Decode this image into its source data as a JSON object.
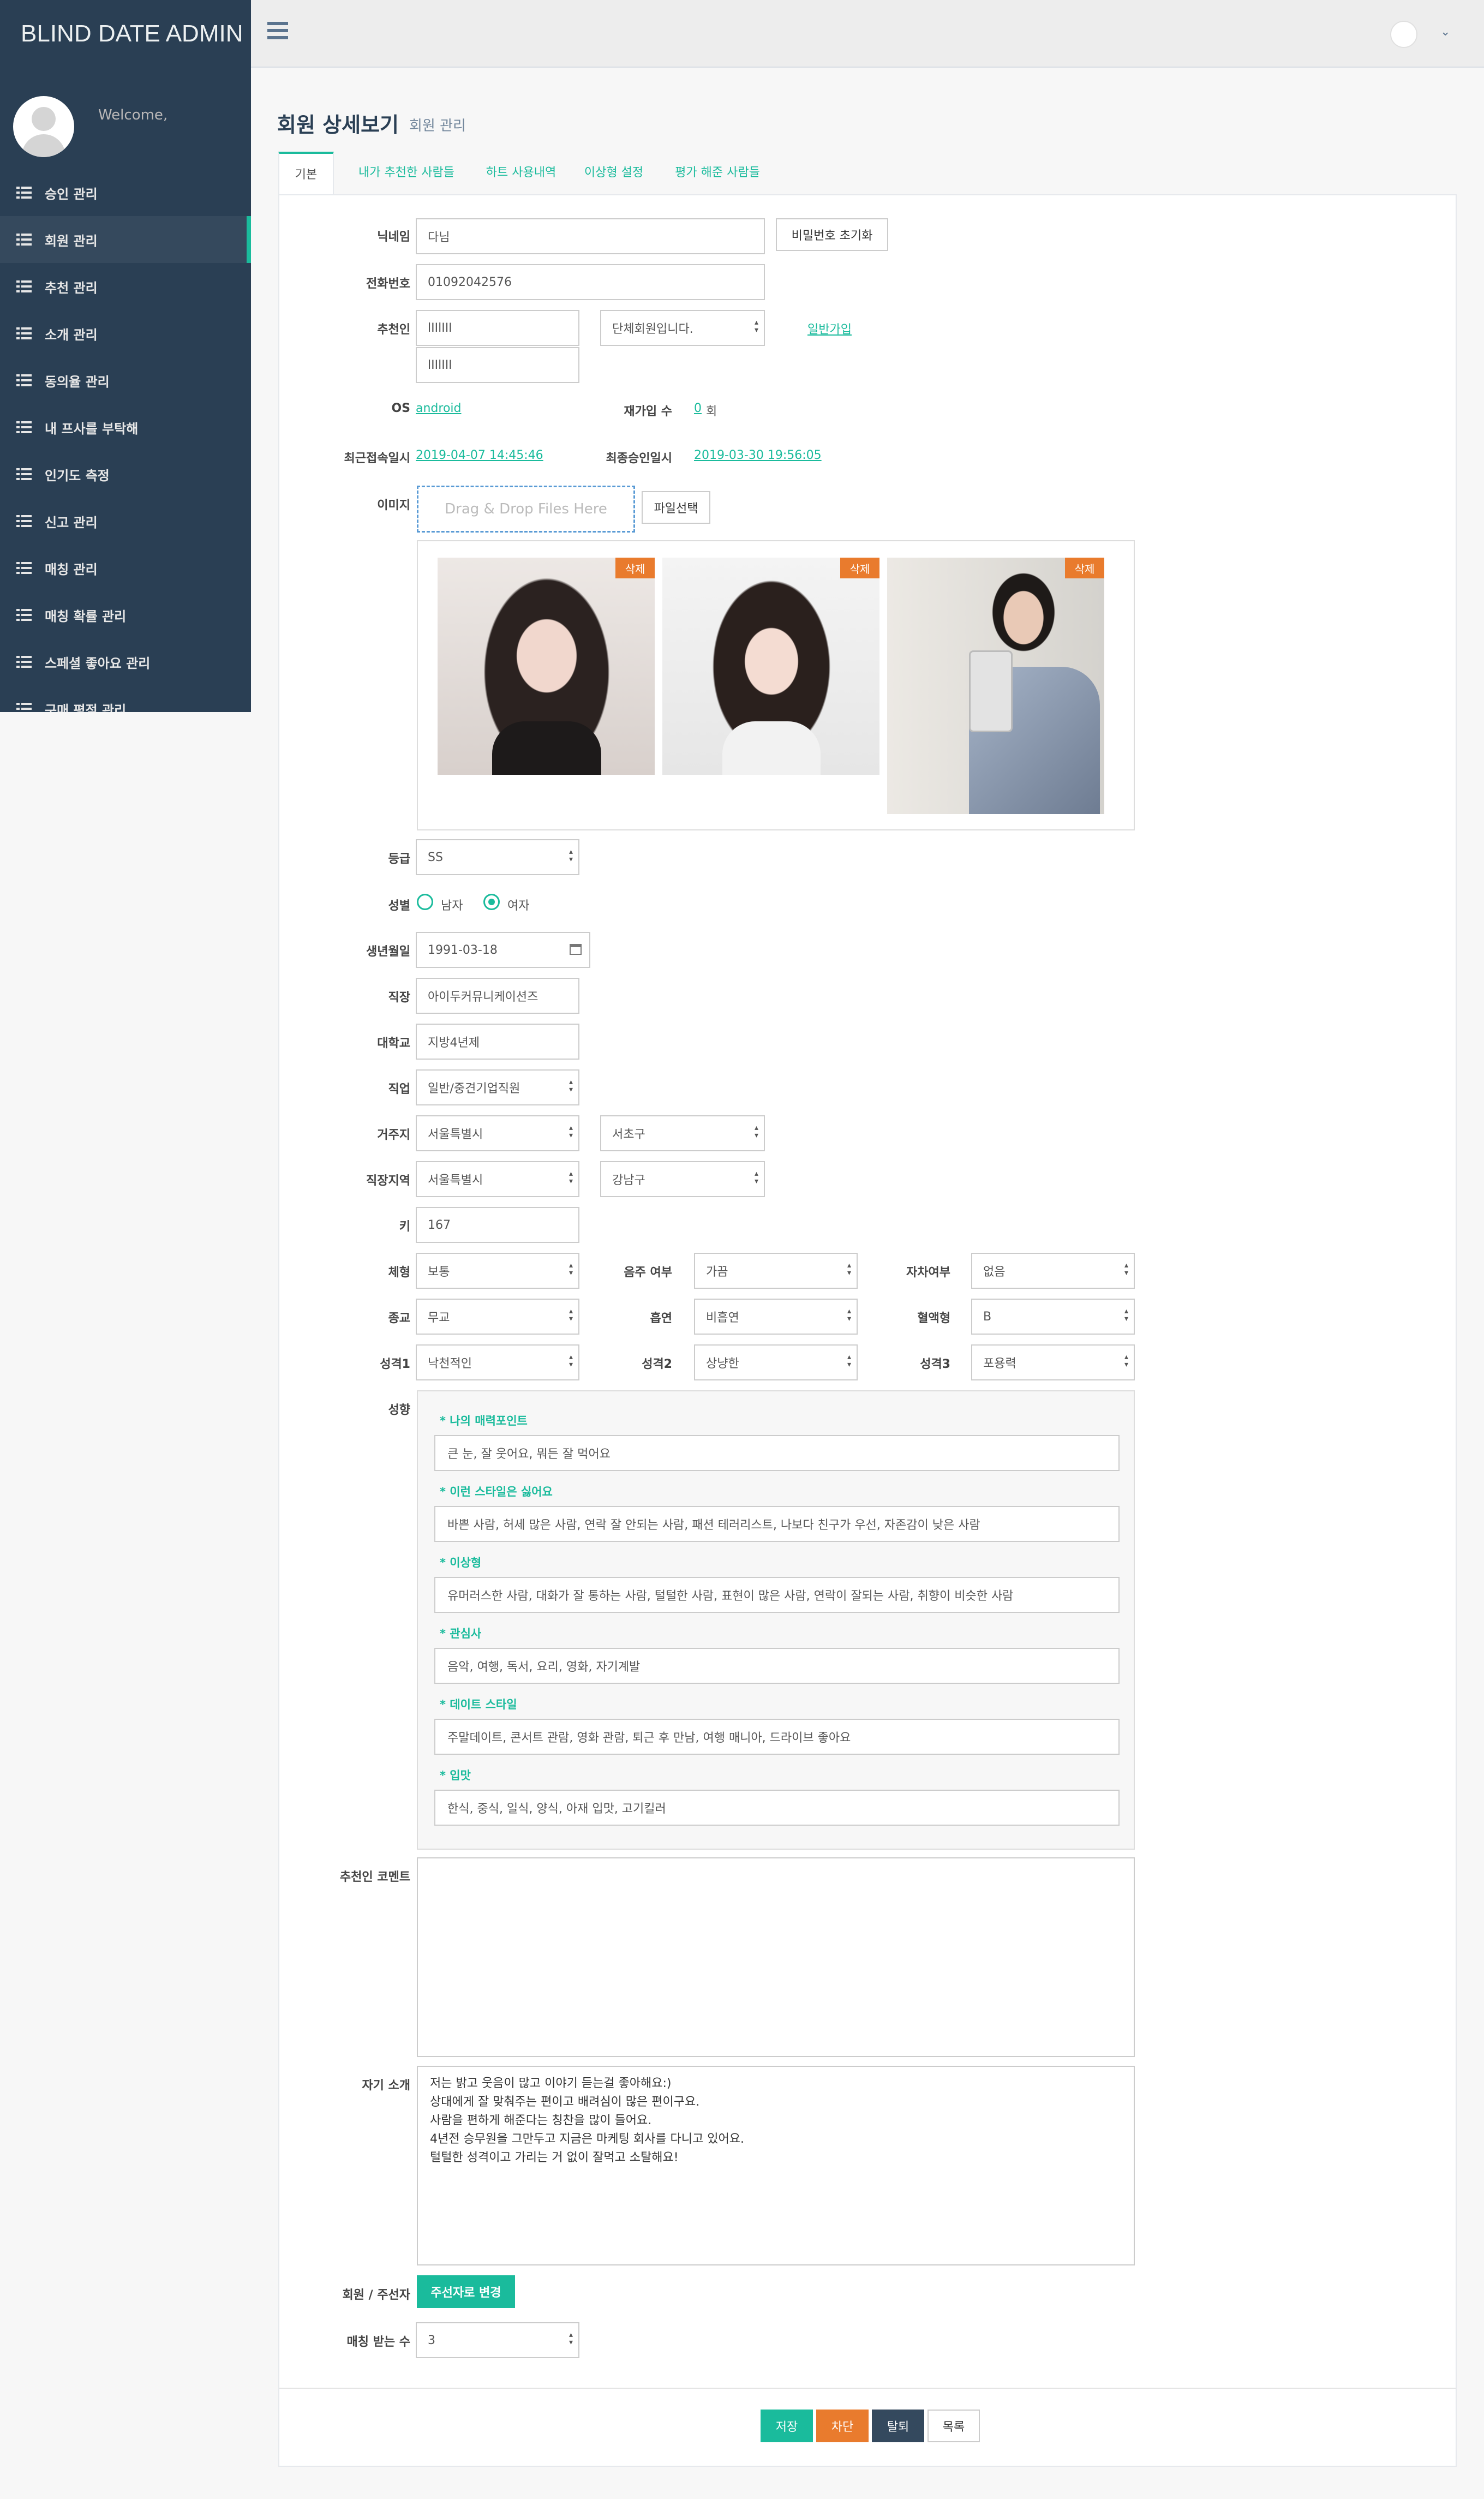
{
  "app": {
    "brand": "BLIND DATE ADMIN",
    "welcome": "Welcome,"
  },
  "sidebar": {
    "items": [
      {
        "label": "승인 관리"
      },
      {
        "label": "회원 관리"
      },
      {
        "label": "추천 관리"
      },
      {
        "label": "소개 관리"
      },
      {
        "label": "동의율 관리"
      },
      {
        "label": "내 프사를 부탁해"
      },
      {
        "label": "인기도 측정"
      },
      {
        "label": "신고 관리"
      },
      {
        "label": "매칭 관리"
      },
      {
        "label": "매칭 확률 관리"
      },
      {
        "label": "스페셜 좋아요 관리"
      },
      {
        "label": "구매 평점 관리"
      }
    ]
  },
  "page": {
    "title": "회원 상세보기",
    "subtitle": "회원 관리"
  },
  "tabs": [
    {
      "label": "기본"
    },
    {
      "label": "내가 추천한 사람들"
    },
    {
      "label": "하트 사용내역"
    },
    {
      "label": "이상형 설정"
    },
    {
      "label": "평가 해준 사람들"
    }
  ],
  "form": {
    "nickname": {
      "label": "닉네임",
      "value": "다님"
    },
    "reset_pw": "비밀번호 초기화",
    "phone": {
      "label": "전화번호",
      "value": "01092042576"
    },
    "recommender": {
      "label": "추천인",
      "value1": "lIIlIII",
      "value2": "lIIlIII",
      "group": "단체회원입니다.",
      "join_link": "일반가입"
    },
    "os": {
      "label": "OS",
      "value": "android"
    },
    "rejoin": {
      "label": "재가입 수",
      "count": "0",
      "unit": "회"
    },
    "last_login": {
      "label": "최근접속일시",
      "value": "2019-04-07 14:45:46"
    },
    "final_approval": {
      "label": "최종승인일시",
      "value": "2019-03-30 19:56:05"
    },
    "image": {
      "label": "이미지",
      "dropzone": "Drag & Drop Files Here",
      "file_button": "파일선택",
      "delete_label": "삭제"
    },
    "grade": {
      "label": "등급",
      "value": "SS"
    },
    "gender": {
      "label": "성별",
      "male": "남자",
      "female": "여자",
      "selected": "여자"
    },
    "birth": {
      "label": "생년월일",
      "value": "1991-03-18"
    },
    "workplace": {
      "label": "직장",
      "value": "아이두커뮤니케이션즈"
    },
    "university": {
      "label": "대학교",
      "value": "지방4년제"
    },
    "job": {
      "label": "직업",
      "value": "일반/중견기업직원"
    },
    "residence": {
      "label": "거주지",
      "city": "서울특별시",
      "district": "서초구"
    },
    "work_area": {
      "label": "직장지역",
      "city": "서울특별시",
      "district": "강남구"
    },
    "height": {
      "label": "키",
      "value": "167"
    },
    "body": {
      "label": "체형",
      "value": "보통"
    },
    "drinking": {
      "label": "음주 여부",
      "value": "가끔"
    },
    "living": {
      "label": "자차여부",
      "value": "없음"
    },
    "religion": {
      "label": "종교",
      "value": "무교"
    },
    "smoking": {
      "label": "흡연",
      "value": "비흡연"
    },
    "blood": {
      "label": "혈액형",
      "value": "B"
    },
    "personality1": {
      "label": "성격1",
      "value": "낙천적인"
    },
    "personality2": {
      "label": "성격2",
      "value": "상냥한"
    },
    "personality3": {
      "label": "성격3",
      "value": "포용력"
    },
    "tendency": {
      "label": "성향",
      "sections": [
        {
          "title": "* 나의 매력포인트",
          "value": "큰 눈, 잘 웃어요, 뭐든 잘 먹어요"
        },
        {
          "title": "* 이런 스타일은 싫어요",
          "value": "바쁜 사람, 허세 많은 사람, 연락 잘 안되는 사람, 패션 테러리스트, 나보다 친구가 우선, 자존감이 낮은 사람"
        },
        {
          "title": "* 이상형",
          "value": "유머러스한 사람, 대화가 잘 통하는 사람, 털털한 사람, 표현이 많은 사람, 연락이 잘되는 사람, 취향이 비슷한 사람"
        },
        {
          "title": "* 관심사",
          "value": "음악, 여행, 독서, 요리, 영화, 자기계발"
        },
        {
          "title": "* 데이트 스타일",
          "value": "주말데이트, 콘서트 관람, 영화 관람, 퇴근 후 만남, 여행 매니아, 드라이브 좋아요"
        },
        {
          "title": "* 입맛",
          "value": "한식, 중식, 일식, 양식, 아재 입맛, 고기킬러"
        }
      ]
    },
    "recommender_comment": {
      "label": "추천인 코멘트",
      "value": ""
    },
    "intro": {
      "label": "자기 소개",
      "value": "저는 밝고 웃음이 많고 이야기 듣는걸 좋아해요:)\n상대에게 잘 맞춰주는 편이고 배려심이 많은 편이구요.\n사람을 편하게 해준다는 칭찬을 많이 들어요.\n4년전  승무원을 그만두고 지금은 마케팅 회사를 다니고 있어요.\n털털한 성격이고 가리는 거 없이 잘먹고 소탈해요!"
    },
    "member_type": {
      "label": "회원 / 주선자",
      "button": "주선자로 변경"
    },
    "match_count": {
      "label": "매칭 받는 수",
      "value": "3"
    }
  },
  "actions": {
    "save": "저장",
    "block": "차단",
    "withdraw": "탈퇴",
    "list": "목록"
  },
  "colors": {
    "accent": "#1abb9c",
    "sidebar": "#2a3f54",
    "danger": "#e97b2d",
    "dark": "#34495e"
  }
}
